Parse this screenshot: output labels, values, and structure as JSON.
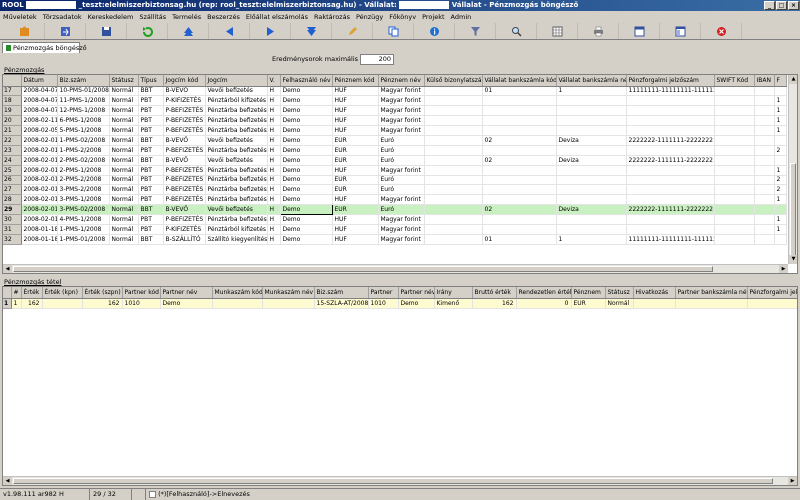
{
  "window": {
    "title_app": "ROOL",
    "title_middle": "_teszt:elelmiszerbiztonsag.hu (rep: rool_teszt:elelmiszerbiztonsag.hu) - Vállalat:",
    "title_right": "Vállalat - Pénzmozgás böngésző",
    "btn_min": "_",
    "btn_max": "□",
    "btn_close": "×"
  },
  "menu": [
    "Műveletek",
    "Törzsadatok",
    "Kereskedelem",
    "Szállítás",
    "Termelés",
    "Beszerzés",
    "Előállat elszámolás",
    "Raktározás",
    "Pénzügy",
    "Főkönyv",
    "Projekt",
    "Admin"
  ],
  "toolbar_icons": [
    "puzzle-icon",
    "export-icon",
    "save-icon",
    "refresh-icon",
    "first-icon",
    "prev-icon",
    "next-icon",
    "last-icon",
    "edit-icon",
    "copy-icon",
    "info-icon",
    "filter-icon",
    "search-icon",
    "grid-icon",
    "print-icon",
    "table-icon",
    "window-icon",
    "close-icon"
  ],
  "tab": {
    "label": "Pénzmozgás böngésző"
  },
  "results": {
    "label": "Eredménysorok maximális száma:",
    "value": "200"
  },
  "upper": {
    "section": "Pénzmozgás",
    "columns": [
      "Dátum",
      "Biz.szám",
      "Státusz",
      "Típus",
      "Jogcím kód",
      "Jogcím",
      "V.",
      "Felhasználó név",
      "Pénznem kód",
      "Pénznem név",
      "Külső bizonylatszám",
      "Vállalat bankszámla kód",
      "Vállalat bankszámla név",
      "Pénzforgalmi jelzőszám",
      "SWIFT Kód",
      "IBAN",
      "F"
    ],
    "rows": [
      [
        "17",
        "2008-04-07",
        "10-PMS-01/2008",
        "Normál",
        "BBT",
        "B-VEVŐ",
        "Vevői befizetés",
        "H",
        "Demo",
        "HUF",
        "Magyar forint",
        "",
        "01",
        "1",
        "11111111-11111111-11111333",
        "",
        "",
        ""
      ],
      [
        "18",
        "2008-04-07",
        "11-PMS-1/2008",
        "Normál",
        "PBT",
        "P-KIFIZETÉS",
        "Pénztárból kifizetés",
        "H",
        "Demo",
        "HUF",
        "Magyar forint",
        "",
        "",
        "",
        "",
        "",
        "",
        "1"
      ],
      [
        "19",
        "2008-04-07",
        "12-PMS-1/2008",
        "Normál",
        "PBT",
        "P-BEFIZETÉS",
        "Pénztárba befizetés",
        "H",
        "Demo",
        "HUF",
        "Magyar forint",
        "",
        "",
        "",
        "",
        "",
        "",
        "1"
      ],
      [
        "20",
        "2008-02-11",
        "6-PMS-1/2008",
        "Normál",
        "PBT",
        "P-BEFIZETÉS",
        "Pénztárba befizetés",
        "H",
        "Demo",
        "HUF",
        "Magyar forint",
        "",
        "",
        "",
        "",
        "",
        "",
        "1"
      ],
      [
        "21",
        "2008-02-05",
        "5-PMS-1/2008",
        "Normál",
        "PBT",
        "P-BEFIZETÉS",
        "Pénztárba befizetés",
        "H",
        "Demo",
        "HUF",
        "Magyar forint",
        "",
        "",
        "",
        "",
        "",
        "",
        "1"
      ],
      [
        "22",
        "2008-02-01",
        "1-PMS-02/2008",
        "Normál",
        "BBT",
        "B-VEVŐ",
        "Vevői befizetés",
        "H",
        "Demo",
        "EUR",
        "Euró",
        "",
        "02",
        "Deviza",
        "2222222-1111111-2222222",
        "",
        "",
        ""
      ],
      [
        "23",
        "2008-02-01",
        "1-PMS-2/2008",
        "Normál",
        "PBT",
        "P-BEFIZETÉS",
        "Pénztárba befizetés",
        "H",
        "Demo",
        "EUR",
        "Euró",
        "",
        "",
        "",
        "",
        "",
        "",
        "2"
      ],
      [
        "24",
        "2008-02-01",
        "2-PMS-02/2008",
        "Normál",
        "BBT",
        "B-VEVŐ",
        "Vevői befizetés",
        "H",
        "Demo",
        "EUR",
        "Euró",
        "",
        "02",
        "Deviza",
        "2222222-1111111-2222222",
        "",
        "",
        ""
      ],
      [
        "25",
        "2008-02-01",
        "2-PMS-1/2008",
        "Normál",
        "PBT",
        "P-BEFIZETÉS",
        "Pénztárba befizetés",
        "H",
        "Demo",
        "HUF",
        "Magyar forint",
        "",
        "",
        "",
        "",
        "",
        "",
        "1"
      ],
      [
        "26",
        "2008-02-01",
        "2-PMS-2/2008",
        "Normál",
        "PBT",
        "P-BEFIZETÉS",
        "Pénztárba befizetés",
        "H",
        "Demo",
        "EUR",
        "Euró",
        "",
        "",
        "",
        "",
        "",
        "",
        "2"
      ],
      [
        "27",
        "2008-02-01",
        "3-PMS-2/2008",
        "Normál",
        "PBT",
        "P-BEFIZETÉS",
        "Pénztárba befizetés",
        "H",
        "Demo",
        "EUR",
        "Euró",
        "",
        "",
        "",
        "",
        "",
        "",
        "2"
      ],
      [
        "28",
        "2008-02-01",
        "3-PMS-1/2008",
        "Normál",
        "PBT",
        "P-BEFIZETÉS",
        "Pénztárba befizetés",
        "H",
        "Demo",
        "HUF",
        "Magyar forint",
        "",
        "",
        "",
        "",
        "",
        "",
        "1"
      ],
      [
        "29",
        "2008-02-01",
        "3-PMS-02/2008",
        "Normál",
        "BBT",
        "B-VEVŐ",
        "Vevői befizetés",
        "H",
        "Demo",
        "EUR",
        "Euró",
        "",
        "02",
        "Deviza",
        "2222222-1111111-2222222",
        "",
        "",
        ""
      ],
      [
        "30",
        "2008-02-01",
        "4-PMS-1/2008",
        "Normál",
        "PBT",
        "P-BEFIZETÉS",
        "Pénztárba befizetés",
        "H",
        "Demo",
        "HUF",
        "Magyar forint",
        "",
        "",
        "",
        "",
        "",
        "",
        "1"
      ],
      [
        "31",
        "2008-01-18",
        "1-PMS-1/2008",
        "Normál",
        "PBT",
        "P-KIFIZETÉS",
        "Pénztárból kifizetés",
        "H",
        "Demo",
        "HUF",
        "Magyar forint",
        "",
        "",
        "",
        "",
        "",
        "",
        "1"
      ],
      [
        "32",
        "2008-01-18",
        "1-PMS-01/2008",
        "Normál",
        "BBT",
        "B-SZÁLLÍTÓ",
        "Szállító kiegyenlítése",
        "H",
        "Demo",
        "HUF",
        "Magyar forint",
        "",
        "01",
        "1",
        "11111111-11111111-11111333",
        "",
        "",
        ""
      ]
    ],
    "selected_row": 12
  },
  "lower": {
    "section": "Pénzmozgás tétel",
    "columns": [
      "#",
      "Érték",
      "Érték (kpn)",
      "Érték (szpn)",
      "Partner kód",
      "Partner név",
      "Munkaszám kód",
      "Munkaszám név",
      "Biz.szám",
      "Partner",
      "Partner név",
      "Irány",
      "Bruttó érték",
      "Rendezetlen érték",
      "Pénznem",
      "Státusz",
      "Hivatkozás",
      "Partner bankszámla név",
      "Pénzforgalmi jelzőszám"
    ],
    "rows": [
      [
        "1",
        "1",
        "162",
        "",
        "162",
        "1010",
        "Demo",
        "",
        "",
        "15-SZLA-AT/2008",
        "1010",
        "Demo",
        "Kimenő",
        "162",
        "0",
        "EUR",
        "Normál",
        "",
        "",
        ""
      ]
    ]
  },
  "status": {
    "version": "v1.98.111 ar982 H",
    "position": "29 / 32",
    "filter": "(*)[Felhasználó]->Elnevezés"
  }
}
